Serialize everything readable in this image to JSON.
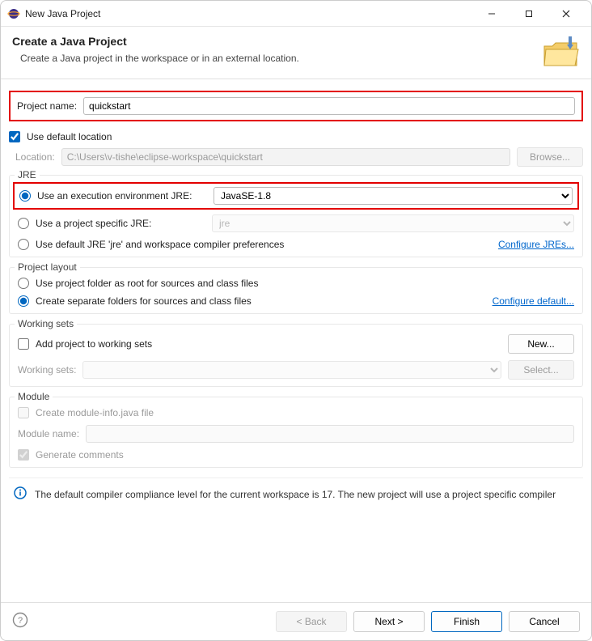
{
  "titlebar": {
    "title": "New Java Project"
  },
  "header": {
    "title": "Create a Java Project",
    "desc": "Create a Java project in the workspace or in an external location."
  },
  "projectName": {
    "label": "Project name:",
    "value": "quickstart"
  },
  "defaultLocation": {
    "label": "Use default location",
    "checked": true
  },
  "location": {
    "label": "Location:",
    "value": "C:\\Users\\v-tishe\\eclipse-workspace\\quickstart",
    "browse": "Browse..."
  },
  "jre": {
    "legend": "JRE",
    "execEnv": {
      "label": "Use an execution environment JRE:",
      "value": "JavaSE-1.8"
    },
    "projSpecific": {
      "label": "Use a project specific JRE:",
      "value": "jre"
    },
    "useDefault": {
      "label": "Use default JRE 'jre' and workspace compiler preferences"
    },
    "configure": "Configure JREs..."
  },
  "layout": {
    "legend": "Project layout",
    "root": "Use project folder as root for sources and class files",
    "separate": "Create separate folders for sources and class files",
    "configure": "Configure default..."
  },
  "workingSets": {
    "legend": "Working sets",
    "add": "Add project to working sets",
    "newBtn": "New...",
    "label": "Working sets:",
    "selectBtn": "Select..."
  },
  "module": {
    "legend": "Module",
    "createInfo": "Create module-info.java file",
    "nameLabel": "Module name:",
    "nameValue": "",
    "genComments": "Generate comments"
  },
  "infoMsg": "The default compiler compliance level for the current workspace is 17. The new project will use a project specific compiler",
  "footer": {
    "back": "< Back",
    "next": "Next >",
    "finish": "Finish",
    "cancel": "Cancel"
  }
}
